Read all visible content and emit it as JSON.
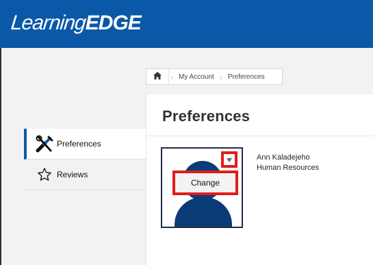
{
  "header": {
    "logo_part1": "Learning",
    "logo_part2": "EDGE",
    "bg_color": "#0b58a8"
  },
  "breadcrumb": {
    "home_icon": "home-icon",
    "items": [
      "My Account",
      "Preferences"
    ]
  },
  "sidebar": {
    "items": [
      {
        "label": "Preferences",
        "icon": "tools-icon",
        "active": true
      },
      {
        "label": "Reviews",
        "icon": "star-icon",
        "active": false
      }
    ]
  },
  "main": {
    "title": "Preferences",
    "profile": {
      "name": "Ann Kaladejeho",
      "department": "Human Resources",
      "photo_menu_option": "Change",
      "dropdown_icon": "caret-down-icon"
    }
  },
  "colors": {
    "accent": "#0b58a8",
    "highlight": "#e11b1b",
    "avatar": "#0b3b77"
  }
}
